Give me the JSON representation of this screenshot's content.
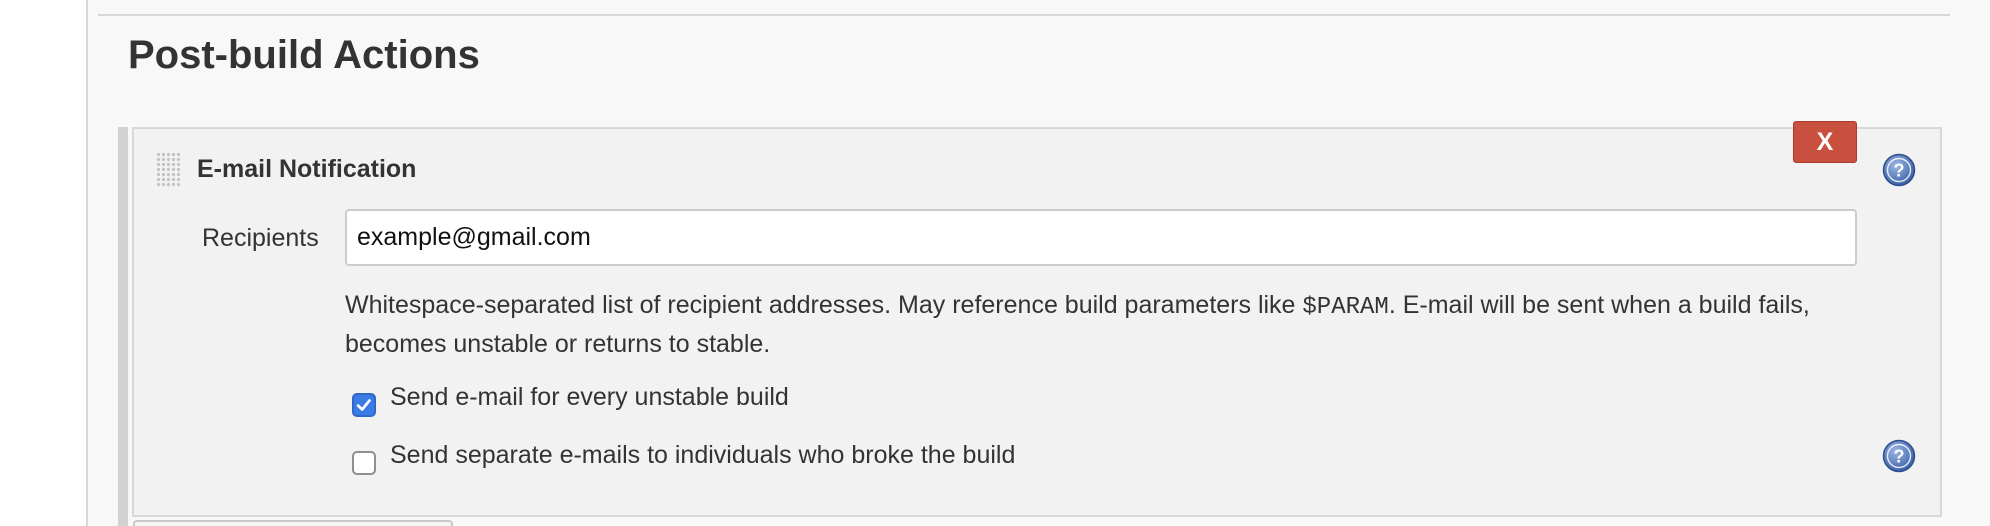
{
  "section": {
    "title": "Post-build Actions"
  },
  "panel": {
    "title": "E-mail Notification",
    "delete_label": "X",
    "recipients": {
      "label": "Recipients",
      "value": "example@gmail.com"
    },
    "help": {
      "text_before": "Whitespace-separated list of recipient addresses. May reference build parameters like ",
      "code": "$PARAM",
      "text_after": ". E-mail will be sent when a build fails, becomes unstable or returns to stable."
    },
    "options": [
      {
        "label": "Send e-mail for every unstable build",
        "checked": true
      },
      {
        "label": "Send separate e-mails to individuals who broke the build",
        "checked": false
      }
    ]
  },
  "icons": {
    "drag_handle": "drag-handle-icon",
    "help": "help-icon",
    "check": "checkmark-icon"
  },
  "colors": {
    "delete_button": "#c9503e",
    "checkbox_checked": "#3b7be6",
    "help_icon": "#4a6fb4"
  }
}
